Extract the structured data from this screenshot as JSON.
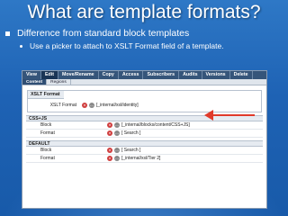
{
  "slide": {
    "title": "What are template formats?",
    "bullet_1": "Difference from standard block templates",
    "bullet_2": "Use a picker to attach to XSLT Format field of a template."
  },
  "screenshot": {
    "tabs": [
      "View",
      "Edit",
      "Move/Rename",
      "Copy",
      "Access",
      "Subscribers",
      "Audits",
      "Versions",
      "Delete"
    ],
    "subtabs": [
      "Content",
      "Regions"
    ],
    "xslt_panel": {
      "header": "XSLT Format",
      "field_label": "XSLT Format",
      "field_value": "[_internal/xsl/identity]"
    },
    "sections": [
      {
        "header": "CSS+JS",
        "rows": [
          {
            "label": "Block",
            "value": "[_internal/blocks/content/CSS+JS]"
          },
          {
            "label": "Format",
            "value": "[ Search ]"
          }
        ]
      },
      {
        "header": "DEFAULT",
        "rows": [
          {
            "label": "Block",
            "value": "[ Search ]"
          },
          {
            "label": "Format",
            "value": "[_internal/xsl/Tier 2]"
          }
        ]
      }
    ],
    "colors": {
      "tab_bar": "#35557a",
      "annotation_arrow": "#e03a2a"
    }
  }
}
